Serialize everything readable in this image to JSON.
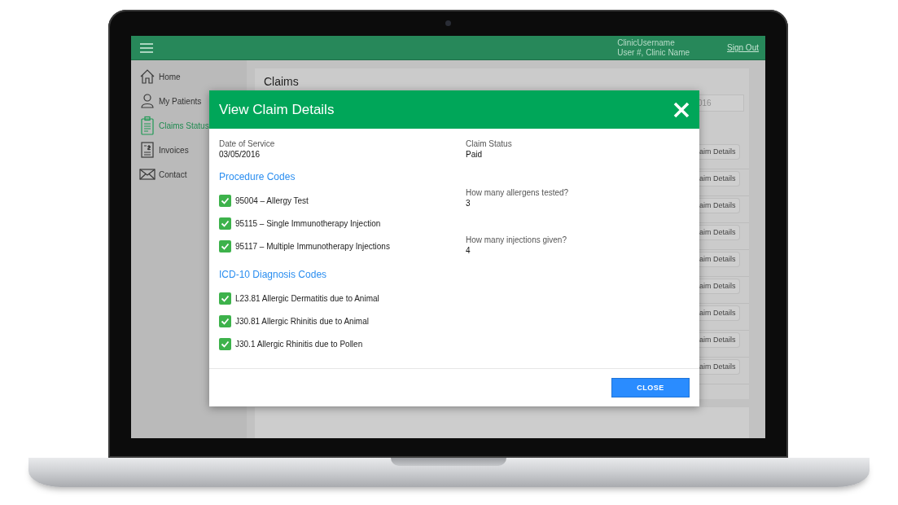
{
  "topbar": {
    "username": "ClinicUsername",
    "user_info": "User #, Clinic Name",
    "sign_out": "Sign Out"
  },
  "sidebar": {
    "items": [
      {
        "label": "Home",
        "kind": "home",
        "selected": false
      },
      {
        "label": "My Patients",
        "kind": "person",
        "selected": false
      },
      {
        "label": "Claims Status",
        "kind": "clipboard",
        "selected": true
      },
      {
        "label": "Invoices",
        "kind": "invoice",
        "selected": false
      },
      {
        "label": "Contact",
        "kind": "mail",
        "selected": false
      }
    ]
  },
  "page": {
    "title": "Claims",
    "date_field_value": "016",
    "row_buttons": [
      "laim Details",
      "laim Details",
      "laim Details",
      "laim Details",
      "laim Details",
      "laim Details",
      "laim Details",
      "laim Details",
      "laim Details"
    ]
  },
  "modal": {
    "title": "View Claim Details",
    "date_of_service": {
      "label": "Date of Service",
      "value": "03/05/2016"
    },
    "claim_status": {
      "label": "Claim Status",
      "value": "Paid"
    },
    "procedure_codes": {
      "heading": "Procedure Codes",
      "items": [
        {
          "label": "95004 – Allergy Test",
          "checked": true
        },
        {
          "label": "95115 – Single Immunotherapy Injection",
          "checked": true
        },
        {
          "label": "95117 – Multiple Immunotherapy Injections",
          "checked": true
        }
      ]
    },
    "questions": [
      {
        "label": "How many allergens tested?",
        "value": "3"
      },
      {
        "label": "How many injections given?",
        "value": "4"
      }
    ],
    "diagnosis_codes": {
      "heading": "ICD-10 Diagnosis Codes",
      "items": [
        {
          "label": "L23.81 Allergic Dermatitis due to Animal",
          "checked": true
        },
        {
          "label": "J30.81 Allergic Rhinitis due to Animal",
          "checked": true
        },
        {
          "label": "J30.1 Allergic Rhinitis due to Pollen",
          "checked": true
        }
      ]
    },
    "close_button": "CLOSE"
  }
}
